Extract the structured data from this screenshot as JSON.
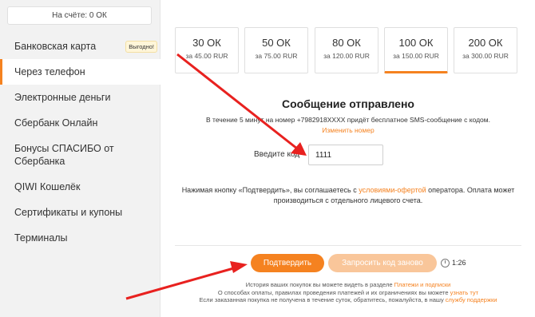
{
  "sidebar": {
    "balance": "На счёте: 0 ОК",
    "items": [
      {
        "label": "Банковская карта",
        "badge": "Выгодно!"
      },
      {
        "label": "Через телефон",
        "active": true
      },
      {
        "label": "Электронные деньги"
      },
      {
        "label": "Сбербанк Онлайн"
      },
      {
        "label": "Бонусы СПАСИБО от Сбербанка"
      },
      {
        "label": "QIWI Кошелёк"
      },
      {
        "label": "Сертификаты и купоны"
      },
      {
        "label": "Терминалы"
      }
    ]
  },
  "amounts": [
    {
      "ok": "30 ОК",
      "price": "за 45.00 RUR"
    },
    {
      "ok": "50 ОК",
      "price": "за 75.00 RUR"
    },
    {
      "ok": "80 ОК",
      "price": "за 120.00 RUR"
    },
    {
      "ok": "100 ОК",
      "price": "за 150.00 RUR",
      "selected": true
    },
    {
      "ok": "200 ОК",
      "price": "за 300.00 RUR"
    }
  ],
  "message": {
    "title": "Сообщение отправлено",
    "info": "В течение 5 минут на номер +7982918XXXX придёт бесплатное SMS-сообщение с кодом.",
    "change_number": "Изменить номер"
  },
  "code": {
    "label": "Введите код",
    "value": "1111"
  },
  "terms": {
    "before": "Нажимая кнопку «Подтвердить», вы соглашаетесь с ",
    "link": "условиями-офертой",
    "after": " оператора. Оплата может производиться с отдельного лицевого счета."
  },
  "actions": {
    "confirm": "Подтвердить",
    "resend": "Запросить код заново",
    "timer": "1:26"
  },
  "footer": {
    "line1_text": "История ваших покупок вы можете видеть в разделе ",
    "line1_link": "Платежи и подписки",
    "line2_text": "О способах оплаты, правилах проведения платежей и их ограничениях вы можете ",
    "line2_link": "узнать тут",
    "line3_text": "Если заказанная покупка не получена в течение суток, обратитесь, пожалуйста, в нашу ",
    "line3_link": "службу поддержки"
  },
  "colors": {
    "accent": "#f58220",
    "arrow": "#e8211f"
  }
}
